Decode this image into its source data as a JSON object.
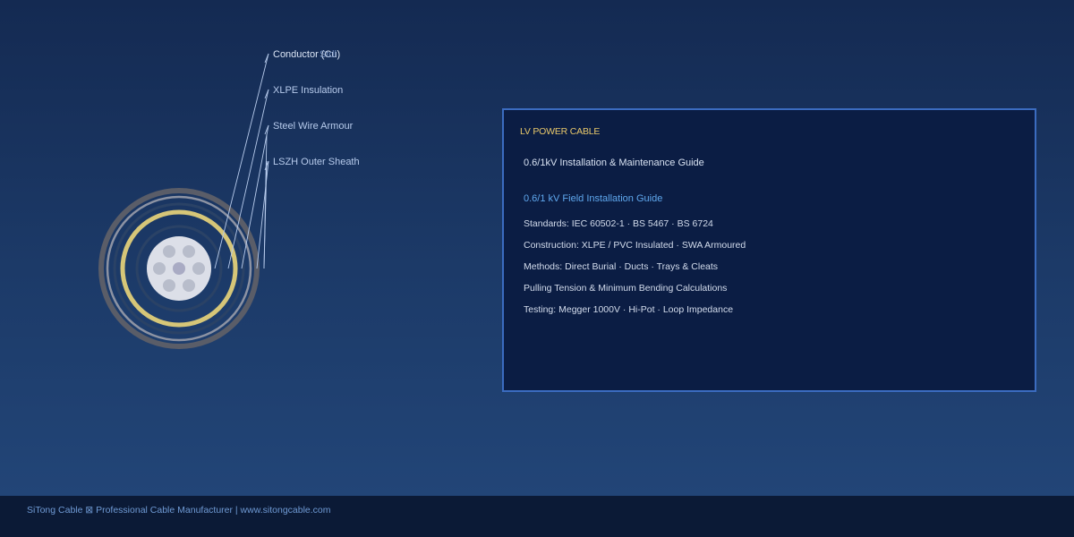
{
  "diagram": {
    "labels": {
      "conductor": "Conductor (Cu)",
      "conductor_overlay": "Stdl",
      "insulation": "XLPE Insulation",
      "armour": "Steel Wire Armour",
      "sheath": "LSZH Outer Sheath"
    },
    "colors": {
      "sheath": "#5a5d68",
      "armour": "#8d93a3",
      "bedding": "#2a4266",
      "screen": "#d6c678",
      "insulation": "#2a4266",
      "core": "#dcdfe8",
      "strand": "#b8bdcb",
      "strand_center": "#a9abc4"
    }
  },
  "panel": {
    "eyebrow": "LV POWER CABLE",
    "subtitle": "0.6/1kV Installation & Maintenance Guide",
    "section_title": "0.6/1 kV Field Installation Guide",
    "items": [
      "Standards: IEC 60502-1 · BS 5467 · BS 6724",
      "Construction: XLPE / PVC Insulated · SWA Armoured",
      "Methods: Direct Burial · Ducts · Trays & Cleats",
      "Pulling Tension & Minimum Bending Calculations",
      "Testing: Megger 1000V · Hi-Pot · Loop Impedance"
    ]
  },
  "footer": {
    "text": "SiTong Cable ⊠ Professional Cable Manufacturer | www.sitongcable.com"
  }
}
